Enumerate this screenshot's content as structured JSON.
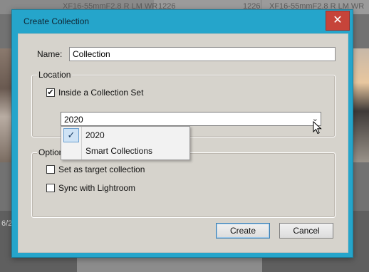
{
  "background": {
    "top_cells": [
      {
        "num": "1226",
        "camera": "XF16-55mmF2.8 R LM WR"
      },
      {
        "num": "1226",
        "camera": "XF16-55mmF2.8 R LM WR"
      }
    ],
    "bottom_text": "6/2"
  },
  "dialog": {
    "title": "Create Collection",
    "close_glyph": "✕",
    "name_label": "Name:",
    "name_value": "Collection",
    "location": {
      "legend": "Location",
      "inside_set_label": "Inside a Collection Set",
      "inside_set_checked": true,
      "selected_set": "2020",
      "dropdown_options": [
        {
          "label": "2020",
          "checked": true
        },
        {
          "label": "Smart Collections",
          "checked": false
        }
      ]
    },
    "options": {
      "legend": "Options",
      "target_label": "Set as target collection",
      "target_checked": false,
      "sync_label": "Sync with Lightroom",
      "sync_checked": false
    },
    "buttons": {
      "create": "Create",
      "cancel": "Cancel"
    }
  },
  "colors": {
    "dialog_frame": "#25a5cb",
    "close_button": "#c6443a",
    "dialog_body": "#d6d3cc",
    "dropdown_highlight": "#cfe3f5"
  }
}
